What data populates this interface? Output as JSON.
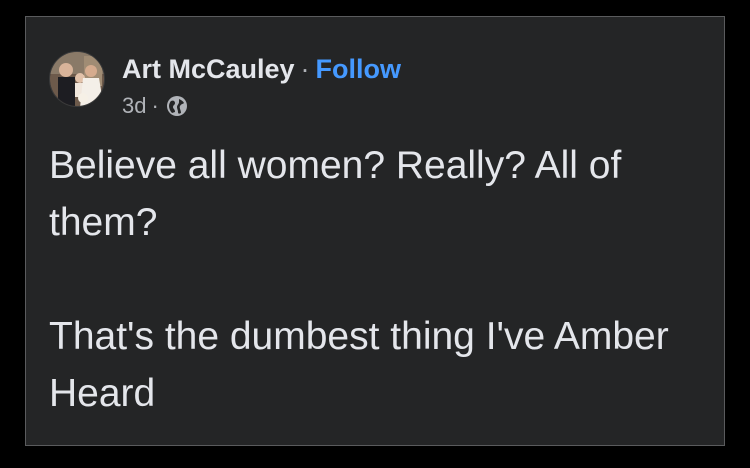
{
  "post": {
    "author_name": "Art McCauley",
    "separator": "·",
    "follow_label": "Follow",
    "timestamp": "3d",
    "meta_separator": "·",
    "privacy_icon": "globe-icon",
    "paragraphs": [
      "Believe all women? Really? All of them?",
      "That's the dumbest thing I've Amber Heard"
    ]
  },
  "colors": {
    "background": "#000000",
    "card": "#242526",
    "text_primary": "#e4e6eb",
    "text_secondary": "#b0b3b8",
    "link": "#4599ff"
  }
}
